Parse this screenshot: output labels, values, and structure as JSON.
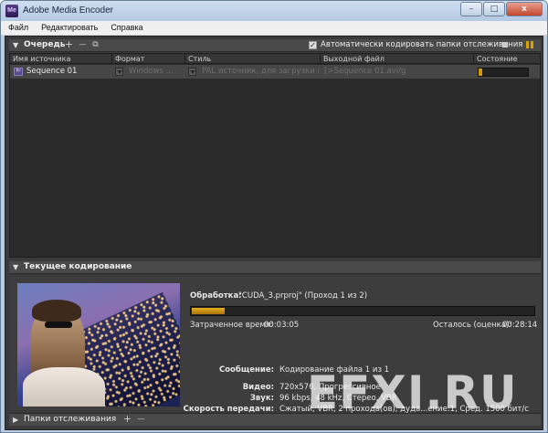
{
  "window": {
    "title": "Adobe Media Encoder",
    "app_icon": "Me",
    "minimize": "–",
    "maximize": "□",
    "close": "x"
  },
  "menu": [
    "Файл",
    "Редактировать",
    "Справка"
  ],
  "queue": {
    "title": "Очередь",
    "add_icon": "+",
    "remove_icon": "—",
    "duplicate_icon": "⧉",
    "auto_encode_checked": true,
    "auto_encode_label": "Автоматически кодировать папки отслеживания",
    "columns": [
      "Имя источника",
      "Формат",
      "Стиль",
      "Выходной файл",
      "Состояние"
    ],
    "rows": [
      {
        "source": "Sequence 01",
        "format": "Windows ...",
        "preset": "PAL источник, для загрузки с...",
        "output": "[>Sequence 01.avi/g",
        "progress": 0.07
      }
    ],
    "accent_color": "#d59b0d"
  },
  "encoding": {
    "title": "Текущее кодирование",
    "processing_label": "Обработка:",
    "processing_value": "\"CUDA_3.prproj\" (Проход 1 из 2)",
    "progress": 0.1,
    "elapsed_label": "Затраченное время:",
    "elapsed_value": "00:03:05",
    "remaining_label": "Осталось (оценка):",
    "remaining_value": "00:28:14",
    "message_label": "Сообщение:",
    "message_value": "Кодирование файла 1 из 1",
    "video_label": "Видео:",
    "video_value": "720x576, Прогрессивное",
    "audio_label": "Звук:",
    "audio_value": "96 kbps, 48 kHz, Стерео, VBR",
    "bitrate_label": "Скорость передачи:",
    "bitrate_value": "Сжатый, VBR, 2 прохода(ов), дуда...ение:1, Сред. 1500 бит/с"
  },
  "watch_folders": {
    "title": "Папки отслеживания",
    "add_icon": "+",
    "remove_icon": "—"
  },
  "watermark": "EFXI.RU"
}
